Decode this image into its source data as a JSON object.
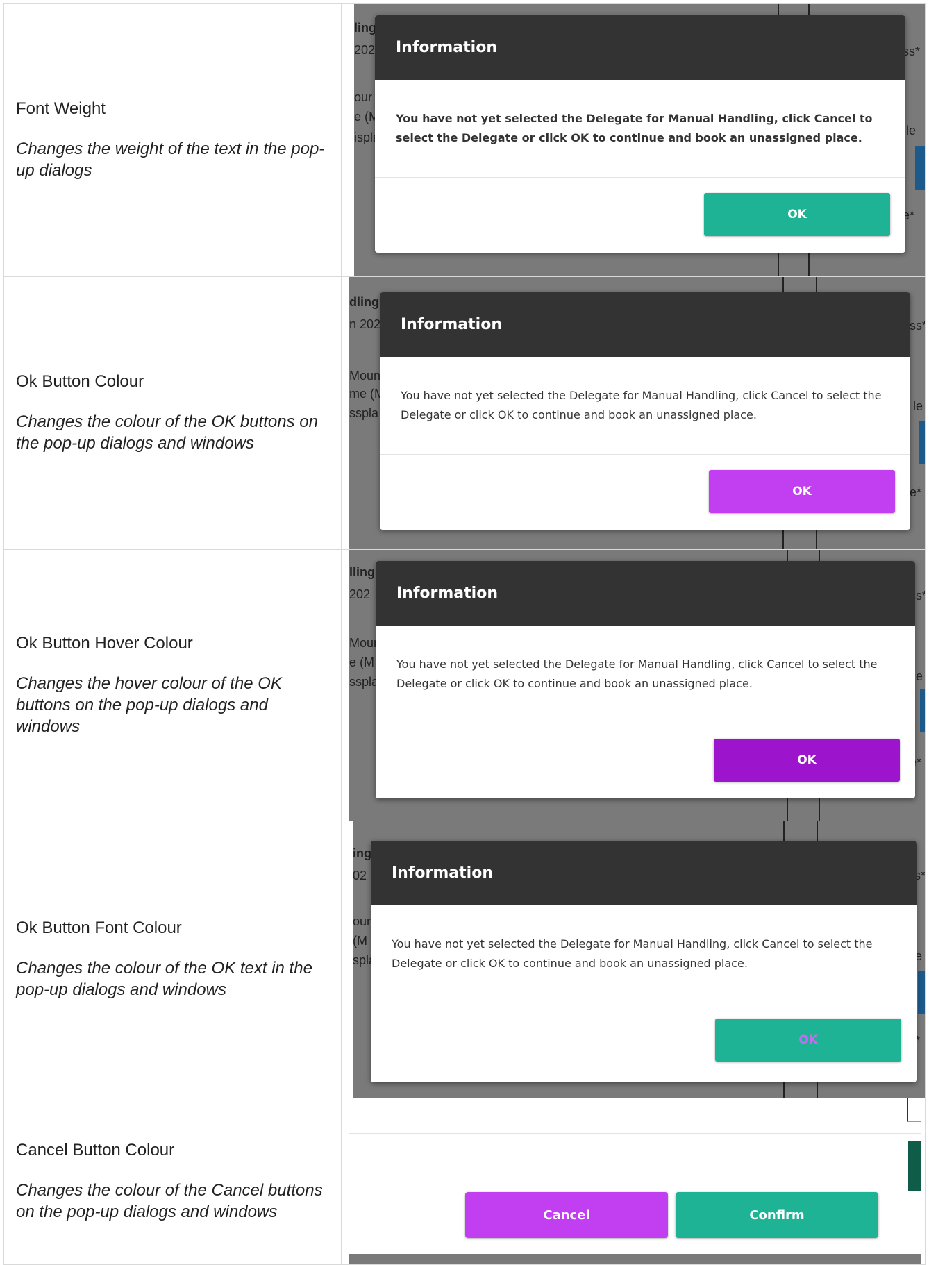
{
  "rows": [
    {
      "name": "Font Weight",
      "description": "Changes the weight of the text in the pop-up dialogs",
      "dialog": {
        "title": "Information",
        "message": "You have not yet selected the Delegate for Manual Handling, click Cancel to select the Delegate or click OK to continue and book an unassigned place.",
        "ok_label": "OK",
        "ok_color": "#1db394",
        "ok_text_color": "#ffffff"
      },
      "background": {
        "frag_a": "ling",
        "frag_b": "202",
        "frag_c": "our",
        "frag_d": "e (M",
        "frag_e": "ispla",
        "frag_f": "ss*",
        "frag_g": "le",
        "frag_h": "e*"
      }
    },
    {
      "name": "Ok Button Colour",
      "description": "Changes the colour of the OK buttons on the pop-up dialogs and windows",
      "dialog": {
        "title": "Information",
        "message": "You have not yet selected the Delegate for Manual Handling, click Cancel to select the Delegate or click OK to continue and book an unassigned place.",
        "ok_label": "OK",
        "ok_color": "#c13ff0",
        "ok_text_color": "#ffffff"
      },
      "background": {
        "frag_a": "dling",
        "frag_b": "n 202",
        "frag_c": "Moun",
        "frag_d": "me (M",
        "frag_e": "sspla",
        "frag_f": "ss*",
        "frag_g": "le",
        "frag_h": "e*"
      }
    },
    {
      "name": "Ok Button Hover Colour",
      "description": "Changes the hover colour of the OK buttons on the pop-up dialogs and windows",
      "dialog": {
        "title": "Information",
        "message": "You have not yet selected the Delegate for Manual Handling, click Cancel to select the Delegate or click OK to continue and book an unassigned place.",
        "ok_label": "OK",
        "ok_color": "#9c14cc",
        "ok_text_color": "#ffffff"
      },
      "background": {
        "frag_a": "lling",
        "frag_b": "202",
        "frag_c": "Moun",
        "frag_d": "e (M",
        "frag_e": "sspla",
        "frag_f": "ss*",
        "frag_g": "le",
        "frag_h": "e*"
      }
    },
    {
      "name": "Ok Button Font Colour",
      "description": "Changes the colour of the OK text in the pop-up dialogs and windows",
      "dialog": {
        "title": "Information",
        "message": "You have not yet selected the Delegate for Manual Handling, click Cancel to select the Delegate or click OK to continue and book an unassigned place.",
        "ok_label": "OK",
        "ok_color": "#1db394",
        "ok_text_color": "#c36ef0"
      },
      "background": {
        "frag_a": "ing",
        "frag_b": "02",
        "frag_c": "our",
        "frag_d": "(M",
        "frag_e": "spla",
        "frag_f": "ss*",
        "frag_g": "le",
        "frag_h": "e*"
      }
    },
    {
      "name": "Cancel Button Colour",
      "description": "Changes the colour of the Cancel buttons on the pop-up dialogs and windows",
      "cancel_label": "Cancel",
      "cancel_color": "#c13ff0",
      "confirm_label": "Confirm",
      "confirm_color": "#1db394"
    }
  ]
}
